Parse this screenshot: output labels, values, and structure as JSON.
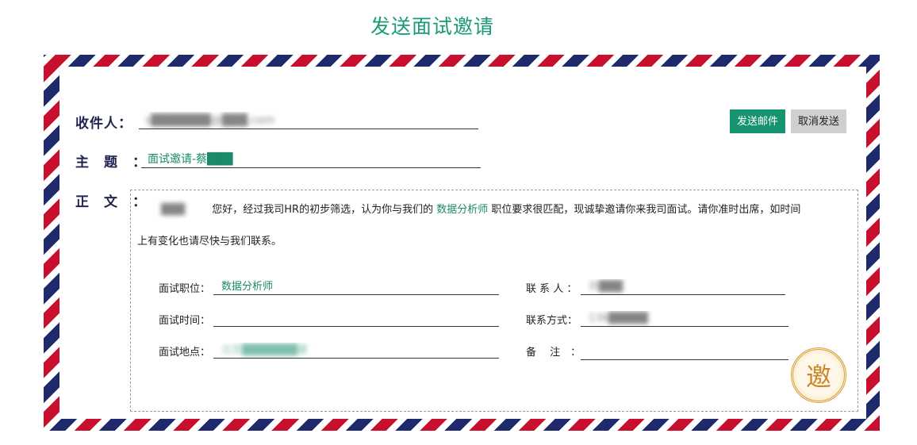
{
  "page": {
    "title": "发送面试邀请"
  },
  "form": {
    "recipient_label": "收件人：",
    "recipient_value": "s███████@███.com",
    "subject_label": "主　题　：",
    "subject_value": "面试邀请-蔡███",
    "body_label": "正　文　："
  },
  "buttons": {
    "send": "发送邮件",
    "cancel": "取消发送"
  },
  "letter": {
    "greeting_name": "███",
    "text_before": "您好，经过我司HR的初步筛选，认为你与我们的",
    "position_highlight": "数据分析师",
    "text_after": "职位要求很匹配，现诚挚邀请你来我司面试。请你准时出席，如时间",
    "line2": "上有变化也请尽快与我们联系。"
  },
  "details": {
    "position_label": "面试职位：",
    "position_value": "数据分析师",
    "time_label": "面试时间：",
    "time_value": "",
    "place_label": "面试地点：",
    "place_value": "北京███████厦",
    "contact_label": "联 系 人 ：",
    "contact_value": "刘███",
    "phone_label": "联系方式：",
    "phone_value": "136█████",
    "note_label": "备　 注　：",
    "note_value": ""
  },
  "seal": {
    "char": "邀"
  },
  "colors": {
    "accent": "#15946f",
    "stripe_red": "#c8102e",
    "stripe_blue": "#1e2a6b"
  }
}
